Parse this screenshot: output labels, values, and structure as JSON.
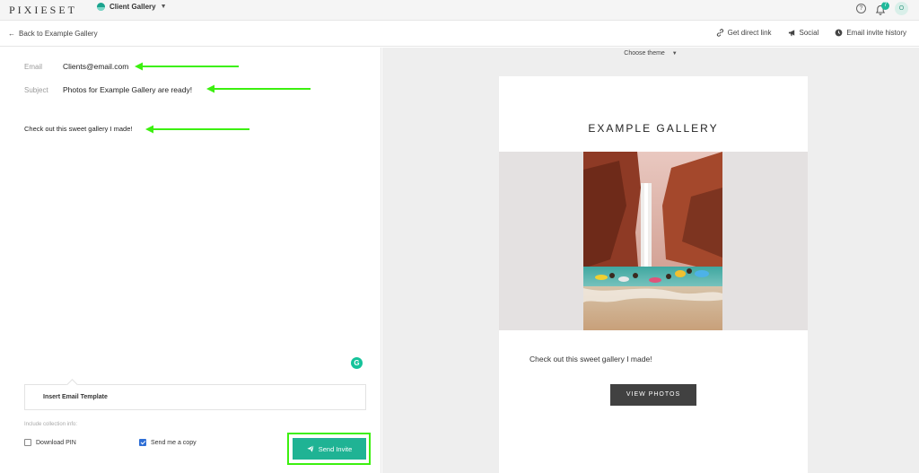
{
  "app": {
    "logo": "PIXIESET",
    "product": "Client Gallery",
    "notification_count": "7",
    "avatar_initial": "O"
  },
  "subbar": {
    "back": "Back to Example Gallery",
    "actions": [
      "Get direct link",
      "Social",
      "Email invite history"
    ]
  },
  "compose": {
    "email_label": "Email",
    "email_value": "Clients@email.com",
    "subject_label": "Subject",
    "subject_value": "Photos for Example Gallery are ready!",
    "message": "Check out this sweet gallery I made!",
    "insert_template": "Insert Email Template",
    "include_info": "Include collection info:",
    "download_pin": "Download PIN",
    "send_copy": "Send me a copy",
    "send_button": "Send Invite"
  },
  "preview": {
    "choose_theme": "Choose theme",
    "gallery_title": "EXAMPLE GALLERY",
    "message": "Check out this sweet gallery I made!",
    "view_button": "VIEW PHOTOS"
  },
  "colors": {
    "accent": "#1fb394",
    "highlight_arrow": "#3cf00f",
    "dark_button": "#414141"
  },
  "icons": {
    "back": "arrow-left-icon",
    "link": "link-icon",
    "social": "megaphone-icon",
    "history": "clock-icon",
    "help": "help-icon",
    "bell": "bell-icon",
    "send": "paper-plane-icon",
    "grammarly": "grammarly-icon"
  }
}
